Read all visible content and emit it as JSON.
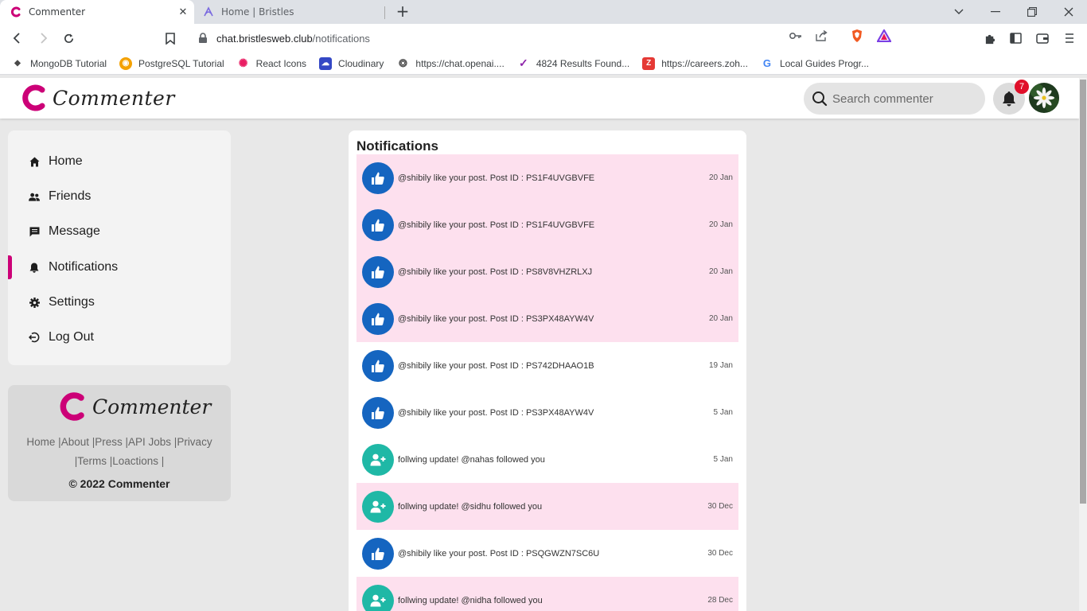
{
  "browser": {
    "tabs": [
      {
        "title": "Commenter",
        "active": true
      },
      {
        "title": "Home | Bristles",
        "active": false
      }
    ],
    "url_host": "chat.bristlesweb.club",
    "url_path": "/notifications",
    "bookmarks": [
      {
        "label": "MongoDB Tutorial",
        "icon": "mongodb-icon",
        "color": "#4a4a4a"
      },
      {
        "label": "PostgreSQL Tutorial",
        "icon": "postgresql-icon",
        "color": "#f4a100"
      },
      {
        "label": "React Icons",
        "icon": "react-icon",
        "color": "#e91e63"
      },
      {
        "label": "Cloudinary",
        "icon": "cloudinary-icon",
        "color": "#3448c5"
      },
      {
        "label": "https://chat.openai....",
        "icon": "openai-icon",
        "color": "#555555"
      },
      {
        "label": "4824 Results Found...",
        "icon": "results-icon",
        "color": "#8e24aa"
      },
      {
        "label": "https://careers.zoh...",
        "icon": "zoho-icon",
        "color": "#e53935"
      },
      {
        "label": "Local Guides Progr...",
        "icon": "google-icon",
        "color": "#4285f4"
      }
    ]
  },
  "site": {
    "brand": "Commenter",
    "search_placeholder": "Search commenter",
    "notification_count": "7",
    "accent": "#cc0077"
  },
  "nav": [
    {
      "label": "Home",
      "icon": "home-icon",
      "active": false
    },
    {
      "label": "Friends",
      "icon": "friends-icon",
      "active": false
    },
    {
      "label": "Message",
      "icon": "message-icon",
      "active": false
    },
    {
      "label": "Notifications",
      "icon": "bell-icon",
      "active": true
    },
    {
      "label": "Settings",
      "icon": "gear-icon",
      "active": false
    },
    {
      "label": "Log Out",
      "icon": "logout-icon",
      "active": false
    }
  ],
  "footer": {
    "brand": "Commenter",
    "links": [
      "Home",
      "About",
      "Press",
      "API Jobs",
      "Privacy",
      "Terms",
      "Loactions"
    ],
    "copyright": "© 2022 Commenter"
  },
  "notifications": {
    "title": "Notifications",
    "items": [
      {
        "type": "like",
        "text": "@shibily like your post. Post ID : PS1F4UVGBVFE",
        "date": "20 Jan",
        "unread": true
      },
      {
        "type": "like",
        "text": "@shibily like your post. Post ID : PS1F4UVGBVFE",
        "date": "20 Jan",
        "unread": true
      },
      {
        "type": "like",
        "text": "@shibily like your post. Post ID : PS8V8VHZRLXJ",
        "date": "20 Jan",
        "unread": true
      },
      {
        "type": "like",
        "text": "@shibily like your post. Post ID : PS3PX48AYW4V",
        "date": "20 Jan",
        "unread": true
      },
      {
        "type": "like",
        "text": "@shibily like your post. Post ID : PS742DHAAO1B",
        "date": "19 Jan",
        "unread": false
      },
      {
        "type": "like",
        "text": "@shibily like your post. Post ID : PS3PX48AYW4V",
        "date": "5 Jan",
        "unread": false
      },
      {
        "type": "follow",
        "text": "follwing update! @nahas followed you",
        "date": "5 Jan",
        "unread": false
      },
      {
        "type": "follow",
        "text": "follwing update! @sidhu followed you",
        "date": "30 Dec",
        "unread": true
      },
      {
        "type": "like",
        "text": "@shibily like your post. Post ID : PSQGWZN7SC6U",
        "date": "30 Dec",
        "unread": false
      },
      {
        "type": "follow",
        "text": "follwing update! @nidha followed you",
        "date": "28 Dec",
        "unread": true
      }
    ]
  }
}
